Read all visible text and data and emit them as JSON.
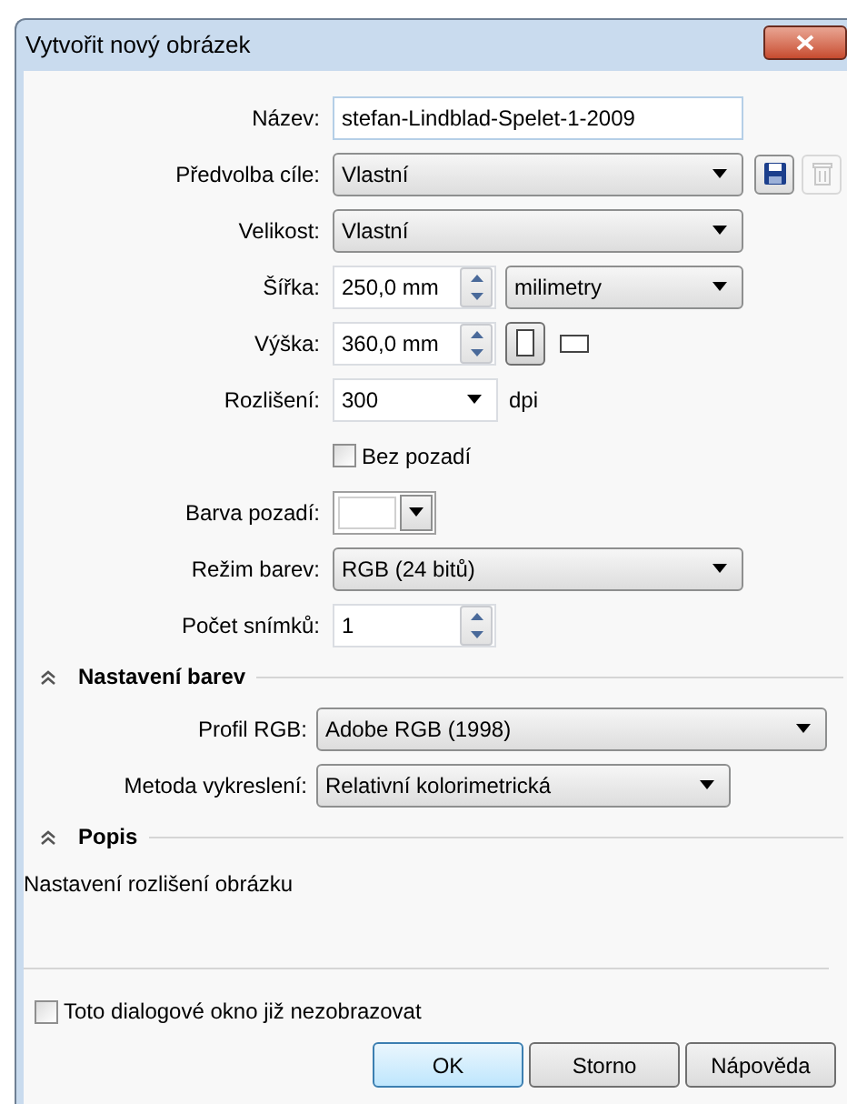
{
  "window": {
    "title": "Vytvořit nový obrázek"
  },
  "fields": [
    {
      "kind": "text",
      "label": "Název:",
      "value": "stefan-Lindblad-Spelet-1-2009"
    },
    {
      "kind": "preset",
      "label": "Předvolba cíle:",
      "value": "Vlastní",
      "save_disabled": false,
      "delete_disabled": true
    },
    {
      "kind": "select",
      "label": "Velikost:",
      "value": "Vlastní"
    },
    {
      "kind": "spin_unit",
      "label": "Šířka:",
      "value": "250,0 mm",
      "unit": "milimetry"
    },
    {
      "kind": "spin_orientation",
      "label": "Výška:",
      "value": "360,0 mm",
      "orientations": [
        {
          "kind": "portrait",
          "selected": true
        },
        {
          "kind": "landscape",
          "selected": false
        }
      ]
    },
    {
      "kind": "combo_suffix",
      "label": "Rozlišení:",
      "value": "300",
      "suffix": "dpi"
    },
    {
      "kind": "checkbox",
      "label": "Bez pozadí",
      "checked": false
    },
    {
      "kind": "color",
      "label": "Barva pozadí:",
      "color": "#ffffff"
    },
    {
      "kind": "select",
      "label": "Režim barev:",
      "value": "RGB (24 bitů)"
    },
    {
      "kind": "spin",
      "label": "Počet snímků:",
      "value": "1"
    }
  ],
  "color_settings": {
    "title": "Nastavení barev",
    "expanded": true,
    "fields": [
      {
        "label": "Profil RGB:",
        "value": "Adobe RGB (1998)"
      },
      {
        "label": "Metoda vykreslení:",
        "value": "Relativní kolorimetrická"
      }
    ]
  },
  "description": {
    "title": "Popis",
    "expanded": true,
    "text": "Nastavení rozlišení obrázku"
  },
  "dont_show": {
    "label": "Toto dialogové okno již nezobrazovat",
    "checked": false
  },
  "buttons": [
    {
      "label": "OK",
      "default": true
    },
    {
      "label": "Storno",
      "default": false
    },
    {
      "label": "Nápověda",
      "default": false
    }
  ]
}
